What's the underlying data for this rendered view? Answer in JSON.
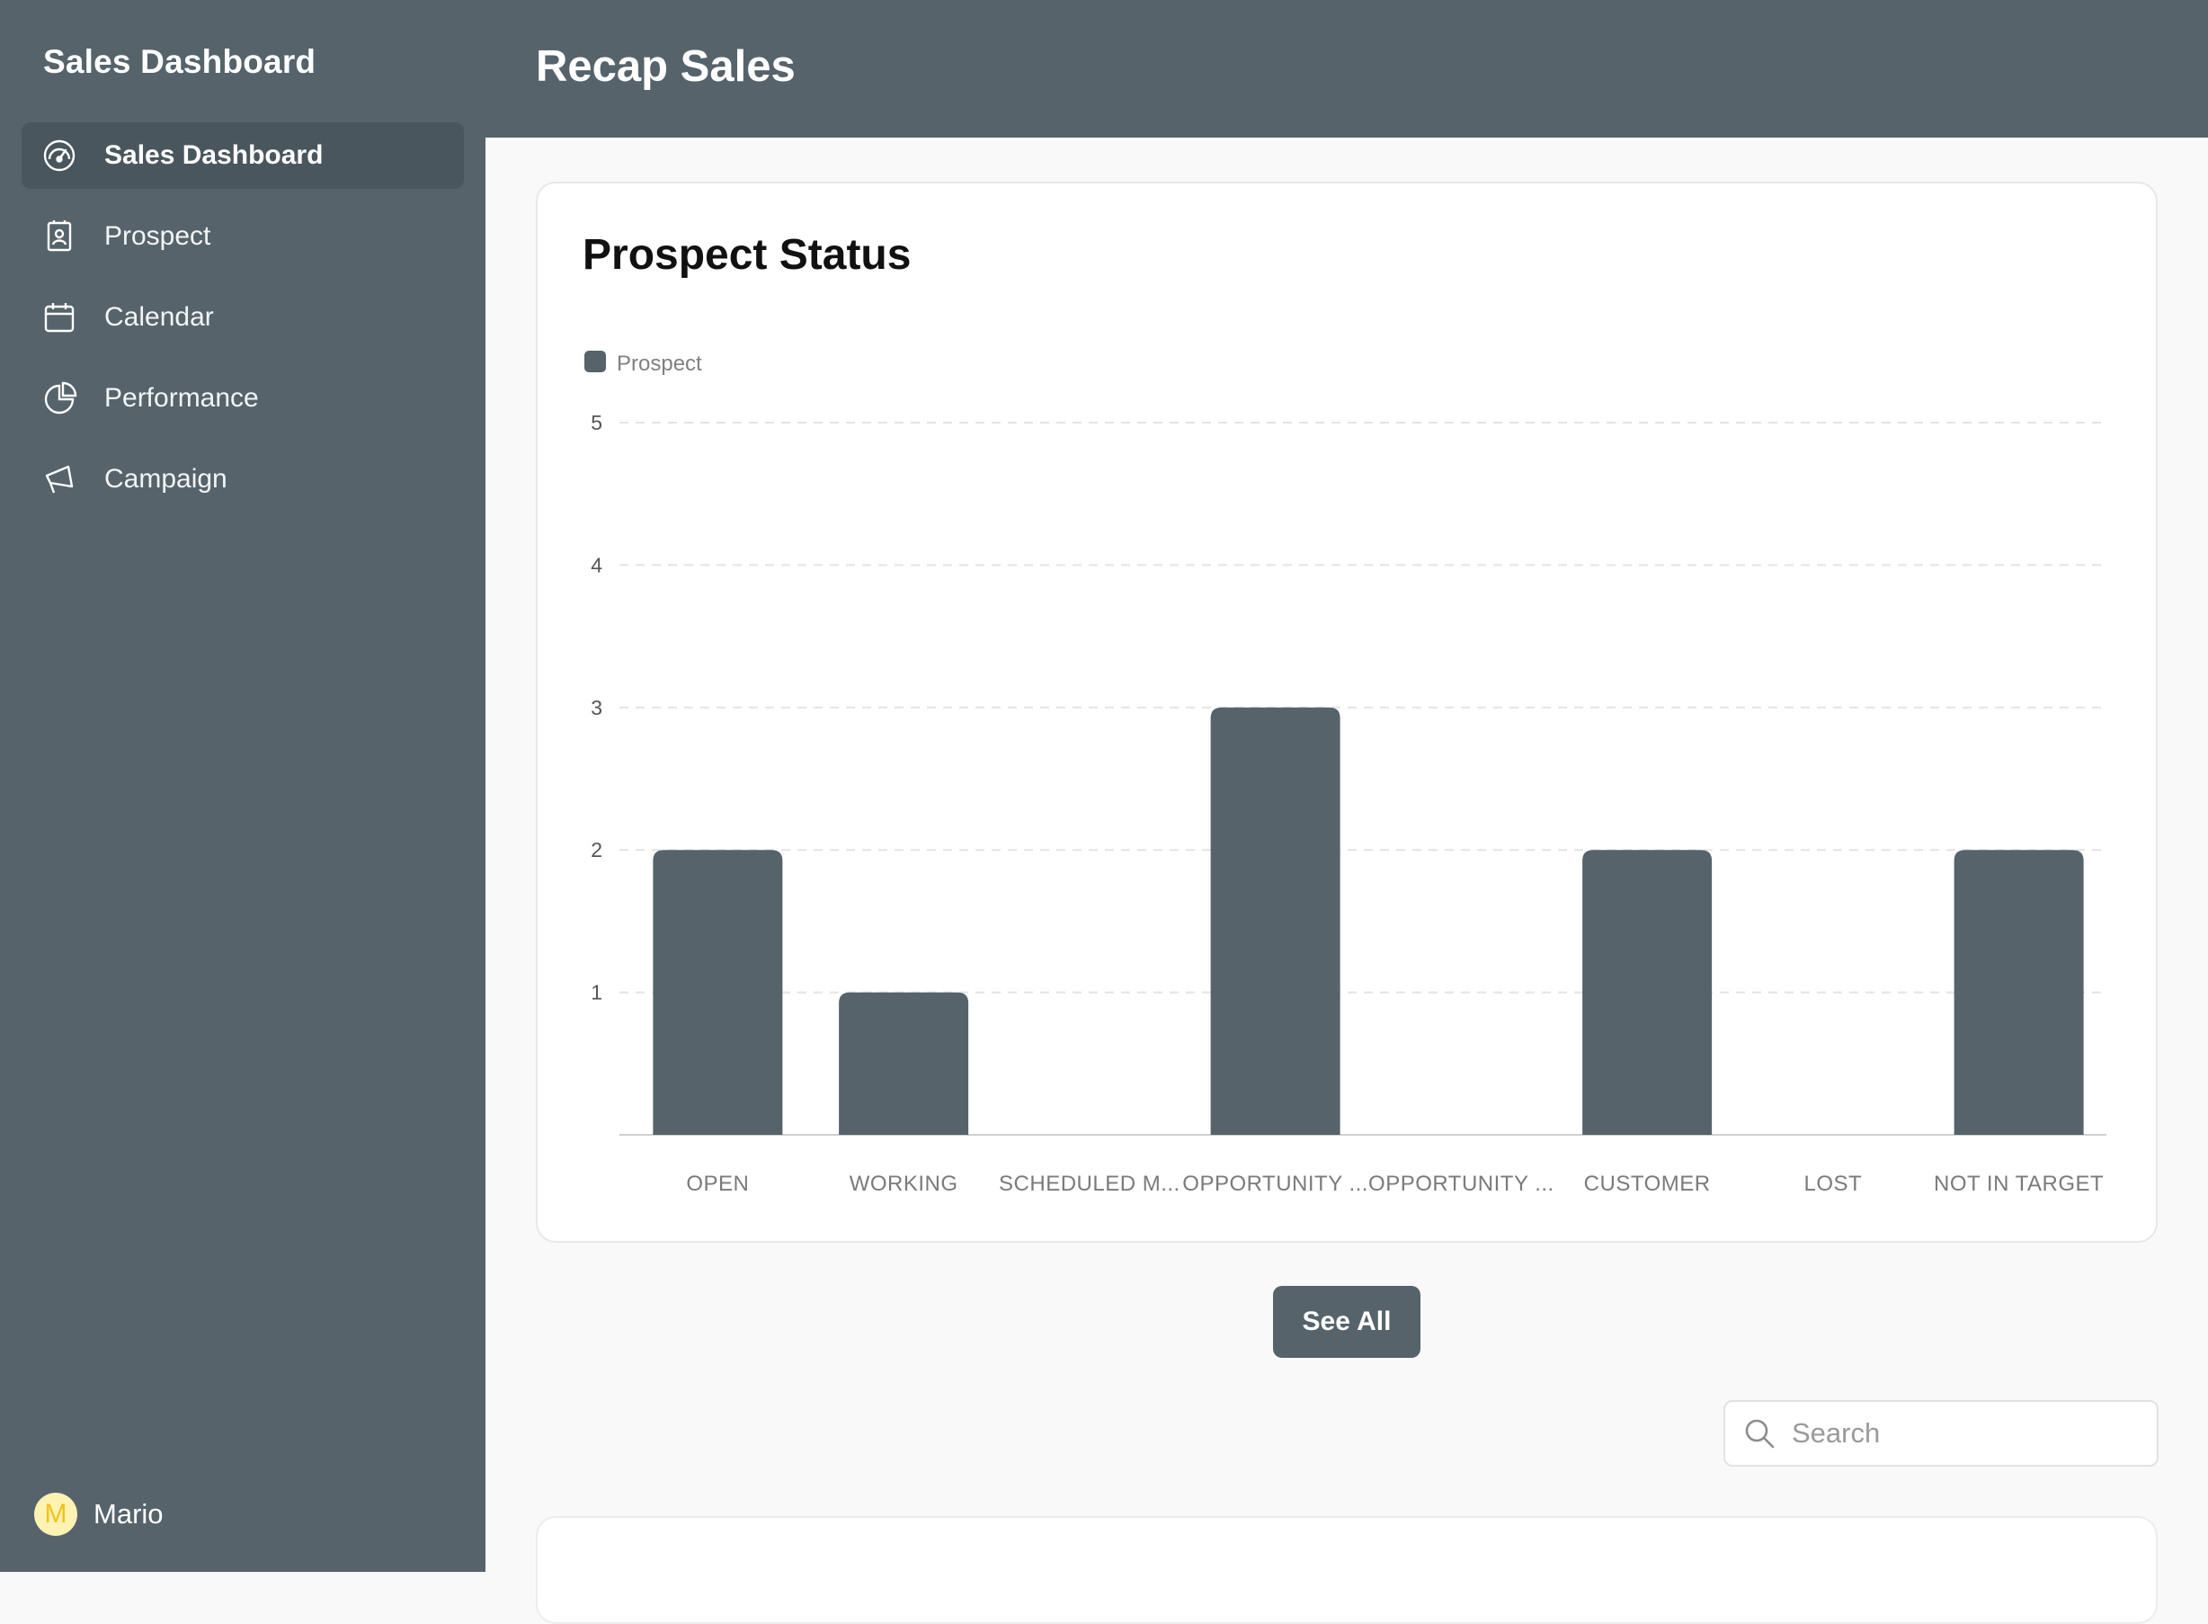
{
  "sidebar": {
    "brand": "Sales Dashboard",
    "items": [
      {
        "label": "Sales Dashboard",
        "icon": "gauge-icon",
        "active": true
      },
      {
        "label": "Prospect",
        "icon": "contact-card-icon",
        "active": false
      },
      {
        "label": "Calendar",
        "icon": "calendar-icon",
        "active": false
      },
      {
        "label": "Performance",
        "icon": "pie-chart-icon",
        "active": false
      },
      {
        "label": "Campaign",
        "icon": "megaphone-icon",
        "active": false
      }
    ],
    "user": {
      "initial": "M",
      "name": "Mario"
    }
  },
  "header": {
    "title": "Recap Sales"
  },
  "card": {
    "title": "Prospect Status"
  },
  "actions": {
    "see_all": "See All"
  },
  "search": {
    "placeholder": "Search",
    "icon": "search-icon"
  },
  "colors": {
    "sidebar_bg": "#56636b",
    "bar": "#56636b",
    "accent_avatar": "#f2c21a"
  },
  "chart_data": {
    "type": "bar",
    "legend": [
      "Prospect"
    ],
    "legend_placement": "top-left",
    "categories": [
      "OPEN",
      "WORKING",
      "SCHEDULED M...",
      "OPPORTUNITY ...",
      "OPPORTUNITY ...",
      "CUSTOMER",
      "LOST",
      "NOT IN TARGET"
    ],
    "series": [
      {
        "name": "Prospect",
        "values": [
          2,
          1,
          0,
          3,
          0,
          2,
          0,
          2
        ]
      }
    ],
    "ylim": [
      0,
      5
    ],
    "yticks": [
      "1",
      "2",
      "3",
      "4",
      "5"
    ],
    "grid": true
  }
}
